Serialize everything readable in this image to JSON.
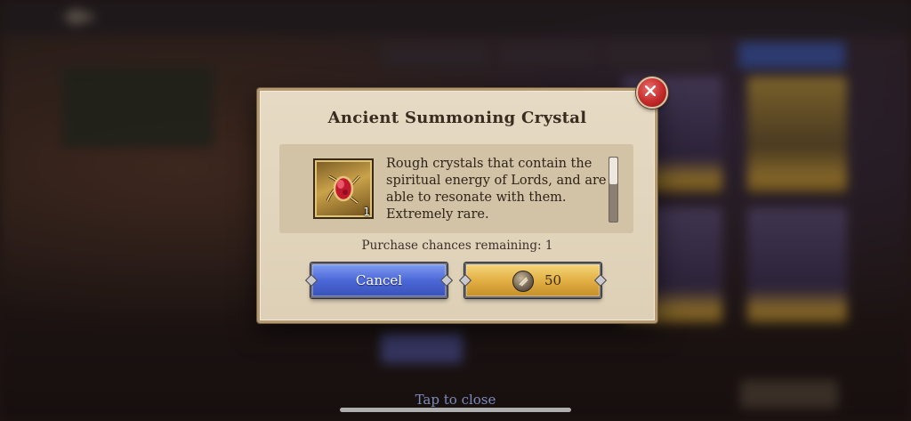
{
  "modal": {
    "title": "Ancient Summoning Crystal",
    "item": {
      "icon": "red-crystal-icon",
      "quantity": "1",
      "description": "Rough crystals that contain the spiritual energy of Lords, and are able to resonate with them. Extremely rare."
    },
    "purchase_chances": "Purchase chances remaining: 1",
    "cancel_label": "Cancel",
    "buy": {
      "currency_icon": "coin-icon",
      "price": "50"
    }
  },
  "tap_to_close": "Tap to close",
  "colors": {
    "cancel_button": "#4c68d8",
    "buy_button": "#e2b045",
    "close_button": "#c42a2a",
    "panel": "#e6dac4"
  }
}
